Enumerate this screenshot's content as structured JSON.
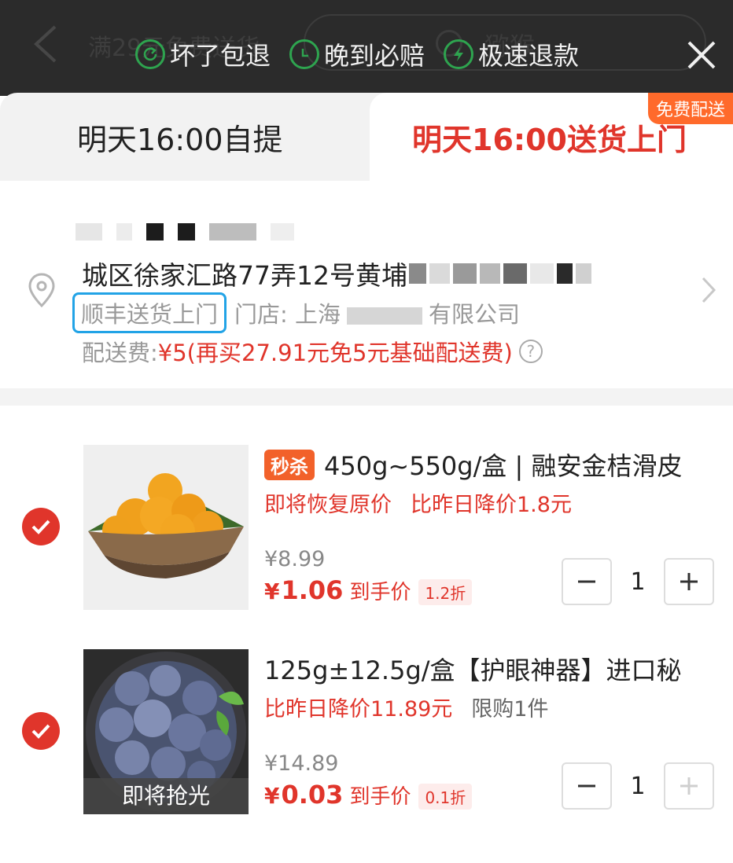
{
  "header": {
    "ghost_title": "满29元免费送货",
    "ghost_search": "猕猴",
    "badges": [
      {
        "label": "坏了包退",
        "icon": "refund-cycle-icon"
      },
      {
        "label": "晚到必赔",
        "icon": "clock-icon"
      },
      {
        "label": "极速退款",
        "icon": "lightning-icon"
      }
    ]
  },
  "delivery": {
    "pickup_label": "明天16:00自提",
    "delivery_label": "明天16:00送货上门",
    "free_badge": "免费配送"
  },
  "address": {
    "line": "城区徐家汇路77弄12号黄埔",
    "service_tag": "顺丰送货上门",
    "store_prefix": "门店: 上海",
    "store_suffix": "有限公司",
    "fee_label": "配送费:",
    "fee_value": "¥5(再买27.91元免5元基础配送费)"
  },
  "items": [
    {
      "tag": "秒杀",
      "name": "450g~550g/盒 | 融安金桔滑皮",
      "promo_red": "即将恢复原价",
      "promo_second": "比昨日降价1.8元",
      "original_price": "¥8.99",
      "currency": "¥",
      "final_price": "1.06",
      "final_label": "到手价",
      "discount": "1.2折",
      "quantity": "1",
      "image": "kumquat-bowl"
    },
    {
      "name": "125g±12.5g/盒【护眼神器】进口秘",
      "promo_red": "比昨日降价11.89元",
      "promo_second": "限购1件",
      "original_price": "¥14.89",
      "currency": "¥",
      "final_price": "0.03",
      "final_label": "到手价",
      "discount": "0.1折",
      "quantity": "1",
      "thumb_label": "即将抢光",
      "image": "blueberry-bowl"
    }
  ],
  "colors": {
    "accent": "#e0352b",
    "badge_green": "#2ea44f",
    "highlight_blue": "#22a3e6",
    "seckill": "#f2612a"
  }
}
